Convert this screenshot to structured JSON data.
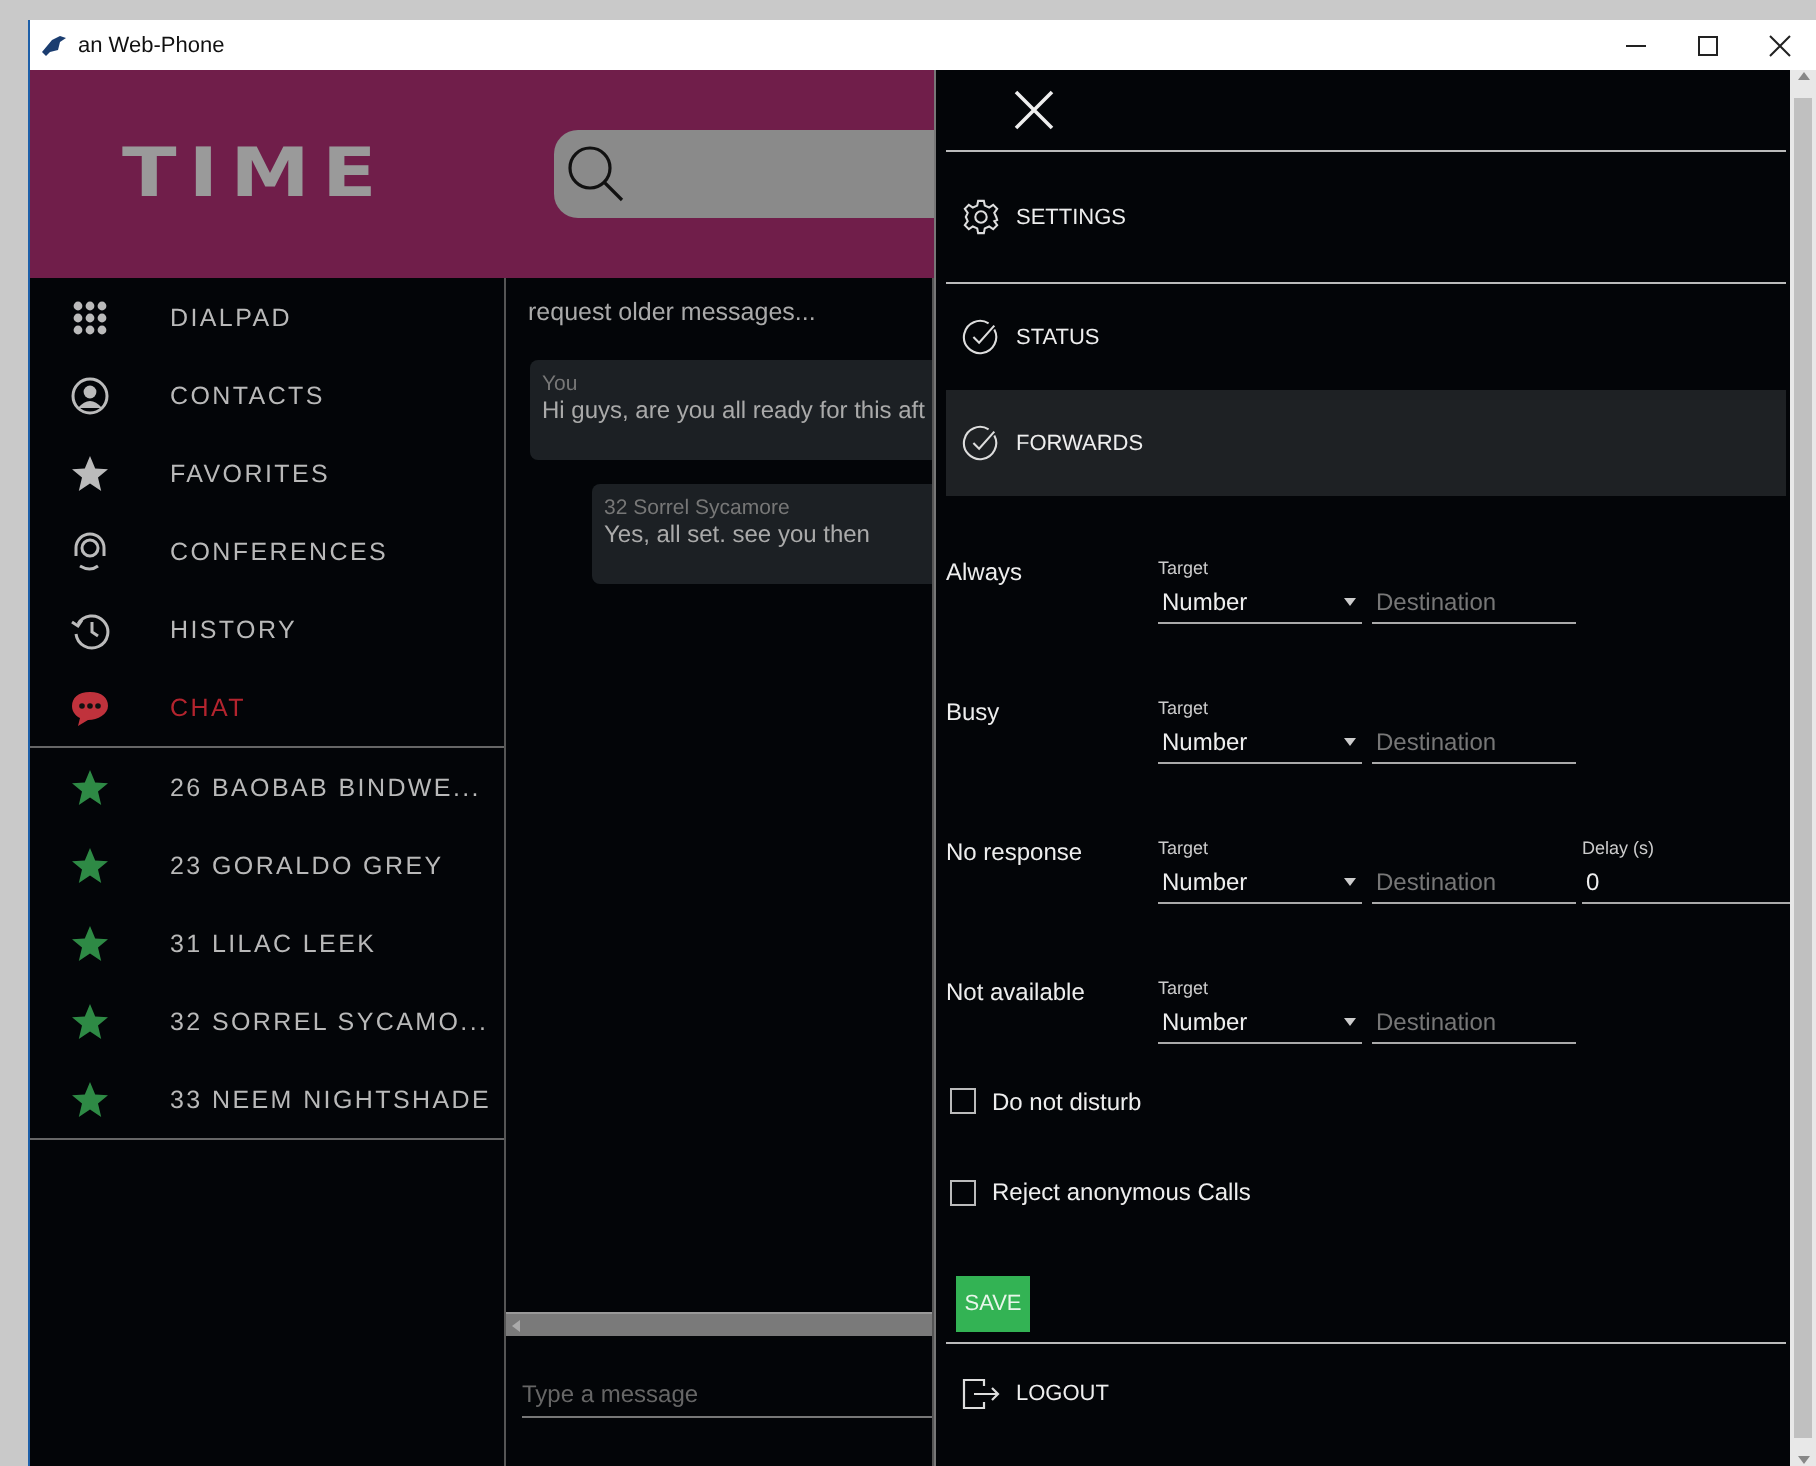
{
  "window": {
    "title": "an Web-Phone"
  },
  "header": {
    "logo": "TIME"
  },
  "nav": [
    {
      "label": "DIALPAD",
      "selected": false
    },
    {
      "label": "CONTACTS",
      "selected": false
    },
    {
      "label": "FAVORITES",
      "selected": false
    },
    {
      "label": "CONFERENCES",
      "selected": false
    },
    {
      "label": "HISTORY",
      "selected": false
    },
    {
      "label": "CHAT",
      "selected": true
    }
  ],
  "favorites": [
    {
      "label": "26 BAOBAB BINDWE..."
    },
    {
      "label": "23 GORALDO GREY"
    },
    {
      "label": "31 LILAC LEEK"
    },
    {
      "label": "32 SORREL SYCAMO..."
    },
    {
      "label": "33 NEEM NIGHTSHADE"
    }
  ],
  "chat": {
    "older_link": "request older messages...",
    "messages": [
      {
        "kind": "outgoing",
        "sender": "You",
        "text": "Hi guys, are you all ready for this aft"
      },
      {
        "kind": "incoming",
        "sender": "32 Sorrel Sycamore",
        "text": "Yes, all set. see you then"
      }
    ],
    "input": {
      "placeholder": "Type a message"
    }
  },
  "panel": {
    "sections": [
      {
        "kind": "gear",
        "label": "SETTINGS",
        "selected": false
      },
      {
        "kind": "check",
        "label": "STATUS",
        "selected": false
      },
      {
        "kind": "check",
        "label": "FORWARDS",
        "selected": true
      }
    ],
    "forwards": [
      {
        "label": "Always",
        "target_label": "Target",
        "target_value": "Number",
        "destination_placeholder": "Destination"
      },
      {
        "label": "Busy",
        "target_label": "Target",
        "target_value": "Number",
        "destination_placeholder": "Destination"
      },
      {
        "label": "No response",
        "target_label": "Target",
        "target_value": "Number",
        "destination_placeholder": "Destination",
        "delay_label": "Delay (s)",
        "delay_value": "0"
      },
      {
        "label": "Not available",
        "target_label": "Target",
        "target_value": "Number",
        "destination_placeholder": "Destination"
      }
    ],
    "checkboxes": [
      {
        "label": "Do not disturb",
        "checked": false
      },
      {
        "label": "Reject anonymous Calls",
        "checked": false
      }
    ],
    "save_button": "SAVE",
    "logout": "LOGOUT"
  }
}
